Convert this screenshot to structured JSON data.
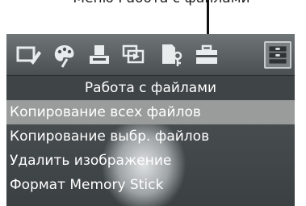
{
  "callout": {
    "label": "Меню Работа с файлами"
  },
  "toolbar": {
    "icons": [
      {
        "name": "edit-slide-icon",
        "selected": false
      },
      {
        "name": "palette-icon",
        "selected": false
      },
      {
        "name": "print-icon",
        "selected": false
      },
      {
        "name": "slideshow-icon",
        "selected": false
      },
      {
        "name": "protect-file-icon",
        "selected": false
      },
      {
        "name": "toolbox-icon",
        "selected": false
      },
      {
        "name": "file-work-icon",
        "selected": true
      }
    ]
  },
  "menu": {
    "title": "Работа с файлами",
    "items": [
      {
        "label": "Копирование всех файлов",
        "active": true
      },
      {
        "label": "Копирование выбр. файлов",
        "active": false
      },
      {
        "label": "Удалить изображение",
        "active": false
      },
      {
        "label": "Формат Memory Stick",
        "active": false
      }
    ]
  }
}
